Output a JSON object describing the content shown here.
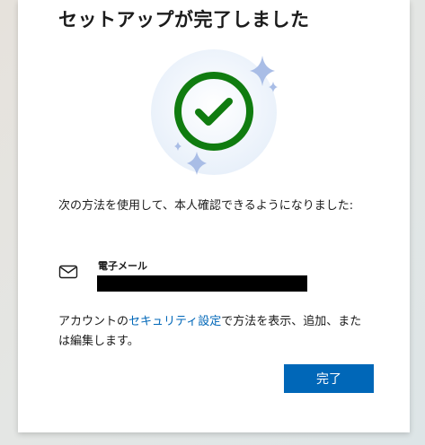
{
  "dialog": {
    "title": "セットアップが完了しました",
    "description": "次の方法を使用して、本人確認できるようになりました:",
    "method": {
      "icon": "envelope-icon",
      "label": "電子メール",
      "value_redacted": true
    },
    "footer": {
      "text_before": "アカウントの",
      "link_text": "セキュリティ設定",
      "text_after": "で方法を表示、追加、または編集します。"
    },
    "done_button_label": "完了"
  },
  "illustration": {
    "icon": "success-checkmark-icon",
    "decorations": [
      "sparkle-icon",
      "sparkle-icon",
      "sparkle-icon",
      "sparkle-icon"
    ]
  },
  "colors": {
    "accent": "#0067b8",
    "success": "#107c10",
    "sparkle": "#a9bde6",
    "circle_bg": "#eef3fb"
  }
}
